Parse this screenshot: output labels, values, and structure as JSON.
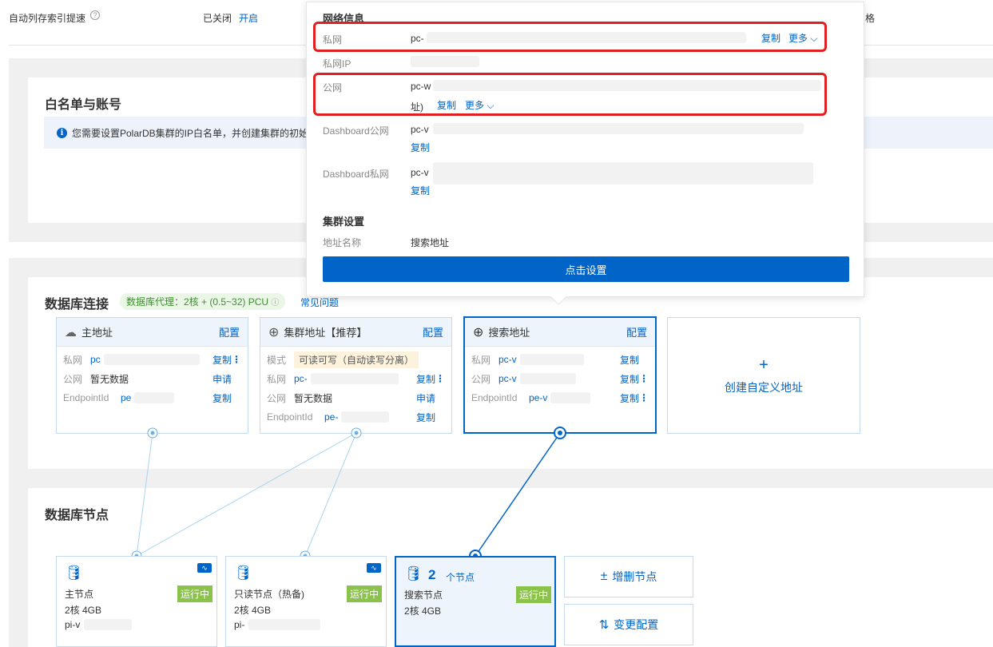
{
  "top": {
    "label": "自动列存索引提速",
    "status": "已关闭",
    "enable": "开启",
    "right_char": "格"
  },
  "whitelist": {
    "title": "白名单与账号",
    "banner": "您需要设置PolarDB集群的IP白名单，并创建集群的初始"
  },
  "db_conn": {
    "title": "数据库连接",
    "proxy_tag": "数据库代理：2核 + (0.5~32) PCU",
    "faq": "常见问题",
    "cards": [
      {
        "title": "主地址",
        "config": "配置",
        "rows": [
          {
            "k": "私网",
            "v": "pc",
            "act": "复制"
          },
          {
            "k": "公网",
            "v": "暂无数据",
            "act": "申请"
          },
          {
            "k": "EndpointId",
            "v": "pe",
            "act": "复制"
          }
        ]
      },
      {
        "title": "集群地址【推荐】",
        "config": "配置",
        "rows": [
          {
            "k": "模式",
            "v": "可读可写（自动读写分离）"
          },
          {
            "k": "私网",
            "v": "pc-",
            "act": "复制"
          },
          {
            "k": "公网",
            "v": "暂无数据",
            "act": "申请"
          },
          {
            "k": "EndpointId",
            "v": "pe-",
            "act": "复制"
          }
        ]
      },
      {
        "title": "搜索地址",
        "config": "配置",
        "rows": [
          {
            "k": "私网",
            "v": "pc-v",
            "act": "复制"
          },
          {
            "k": "公网",
            "v": "pc-v",
            "act": "复制"
          },
          {
            "k": "EndpointId",
            "v": "pe-v",
            "act": "复制"
          }
        ]
      }
    ],
    "create": "创建自定义地址"
  },
  "nodes": {
    "title": "数据库节点",
    "items": [
      {
        "name": "主节点",
        "spec": "2核 4GB",
        "id": "pi-v",
        "status": "运行中"
      },
      {
        "name": "只读节点（热备)",
        "spec": "2核 4GB",
        "id": "pi-",
        "status": "运行中"
      },
      {
        "count": "2",
        "count_unit": "个节点",
        "name": "搜索节点",
        "spec": "2核 4GB",
        "status": "运行中"
      }
    ],
    "add_remove": "增删节点",
    "change_config": "变更配置"
  },
  "popover": {
    "network_title": "网络信息",
    "private_k": "私网",
    "private_v": "pc-",
    "copy": "复制",
    "more": "更多",
    "private_ip_k": "私网IP",
    "public_k": "公网",
    "public_v": "pc-w",
    "public_suffix": "址)",
    "dash_public_k": "Dashboard公网",
    "dash_public_v": "pc-v",
    "dash_private_k": "Dashboard私网",
    "dash_private_v": "pc-v",
    "cluster_title": "集群设置",
    "addr_name_k": "地址名称",
    "addr_name_v": "搜索地址",
    "button": "点击设置"
  },
  "colors": {
    "accent": "#0064c8",
    "running": "#8bc34a",
    "highlight": "#e02020"
  }
}
